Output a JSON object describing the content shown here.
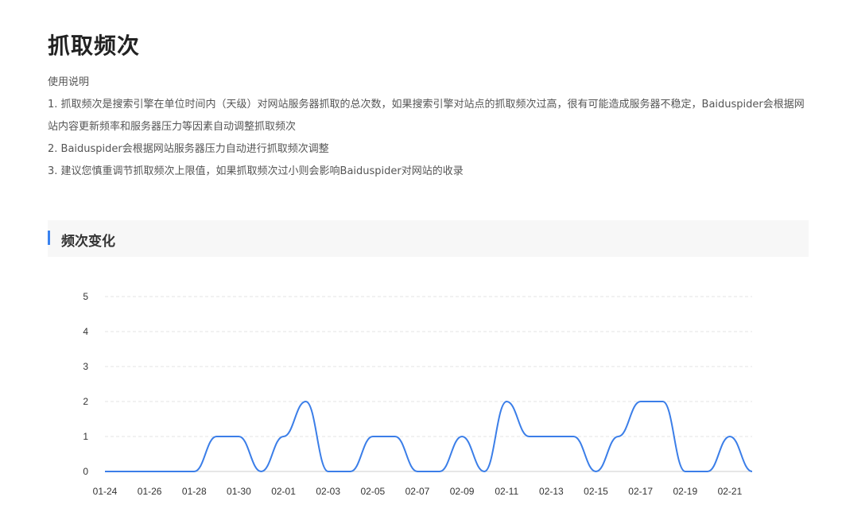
{
  "page": {
    "title": "抓取频次",
    "usage_heading": "使用说明",
    "notes": [
      "1. 抓取频次是搜索引擎在单位时间内（天级）对网站服务器抓取的总次数，如果搜索引擎对站点的抓取频次过高，很有可能造成服务器不稳定，Baiduspider会根据网站内容更新频率和服务器压力等因素自动调整抓取频次",
      "2. Baiduspider会根据网站服务器压力自动进行抓取频次调整",
      "3. 建议您慎重调节抓取频次上限值，如果抓取频次过小则会影响Baiduspider对网站的收录"
    ]
  },
  "section": {
    "title": "频次变化"
  },
  "colors": {
    "accent": "#3a82ef",
    "line": "#3b7ee8",
    "grid": "#e3e3e3",
    "axis": "#cccccc"
  },
  "chart_data": {
    "type": "line",
    "title": "",
    "xlabel": "",
    "ylabel": "",
    "ylim": [
      0,
      5
    ],
    "yticks": [
      0,
      1,
      2,
      3,
      4,
      5
    ],
    "grid": true,
    "smooth": true,
    "x": [
      "01-24",
      "01-25",
      "01-26",
      "01-27",
      "01-28",
      "01-29",
      "01-30",
      "01-31",
      "02-01",
      "02-02",
      "02-03",
      "02-04",
      "02-05",
      "02-06",
      "02-07",
      "02-08",
      "02-09",
      "02-10",
      "02-11",
      "02-12",
      "02-13",
      "02-14",
      "02-15",
      "02-16",
      "02-17",
      "02-18",
      "02-19",
      "02-20",
      "02-21",
      "02-22"
    ],
    "x_tick_labels": [
      "01-24",
      "01-26",
      "01-28",
      "01-30",
      "02-01",
      "02-03",
      "02-05",
      "02-07",
      "02-09",
      "02-11",
      "02-13",
      "02-15",
      "02-17",
      "02-19",
      "02-21"
    ],
    "series": [
      {
        "values": [
          0,
          0,
          0,
          0,
          0,
          1,
          1,
          0,
          1,
          2,
          0,
          0,
          1,
          1,
          0,
          0,
          1,
          0,
          2,
          1,
          1,
          1,
          0,
          1,
          2,
          2,
          0,
          0,
          1,
          0
        ]
      }
    ]
  }
}
